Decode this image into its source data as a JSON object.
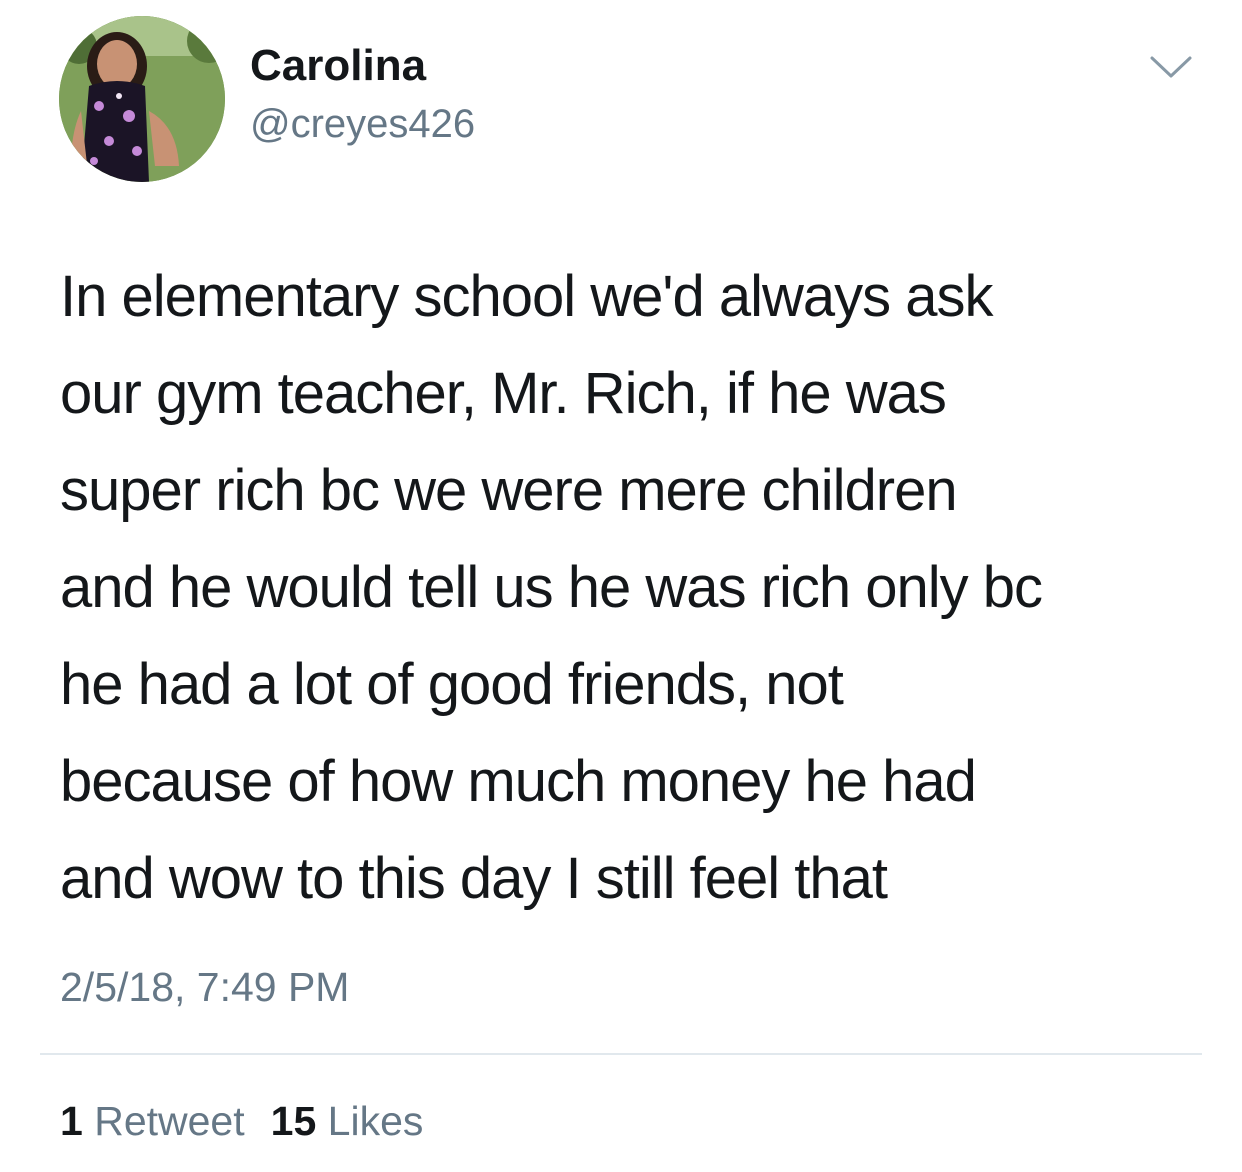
{
  "tweet": {
    "author": {
      "display_name": "Carolina",
      "handle": "@creyes426"
    },
    "text_lines": [
      "In elementary school we'd always ask",
      "our gym teacher, Mr. Rich, if he was",
      "super rich bc we were mere children",
      "and he would tell us he was rich only bc",
      "he had a lot of good friends, not",
      "because of how much money he had",
      "and wow to this day I still feel that"
    ],
    "timestamp": "2/5/18, 7:49 PM",
    "stats": {
      "retweets_count": "1",
      "retweets_label": "Retweet",
      "likes_count": "15",
      "likes_label": "Likes"
    }
  },
  "icons": {
    "menu": "chevron-down-icon"
  },
  "colors": {
    "text_primary": "#14171a",
    "text_secondary": "#657786",
    "divider": "#e1e8ed",
    "background": "#ffffff"
  }
}
